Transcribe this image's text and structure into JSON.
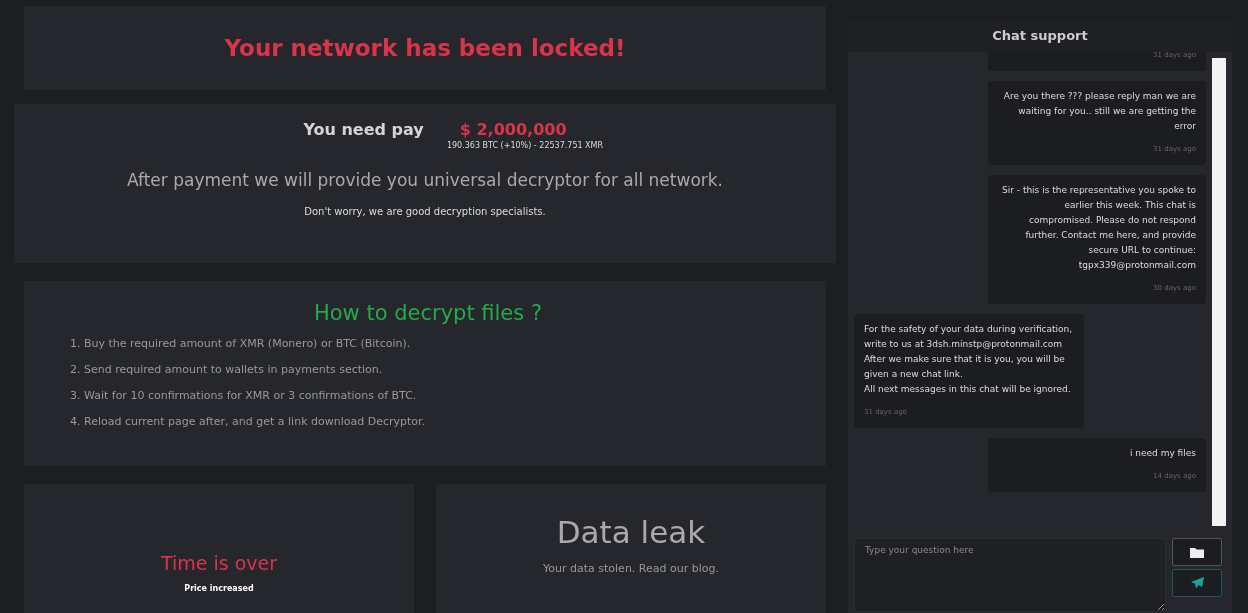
{
  "banner": {
    "title": "Your network has been locked!"
  },
  "payment": {
    "label": "You need pay",
    "amount": "$ 2,000,000",
    "conversion": "190.363 BTC (+10%) - 22537.751 XMR",
    "promise": "After payment we will provide you universal decryptor for all network.",
    "reassurance": "Don't worry, we are good decryption specialists."
  },
  "instructions": {
    "title": "How to decrypt files ?",
    "steps": [
      "1. Buy the required amount of XMR (Monero) or BTC (Bitcoin).",
      "2. Send required amount to wallets in payments section.",
      "3. Wait for 10 confirmations for XMR or 3 confirmations of BTC.",
      "4. Reload current page after, and get a link download Decryptor."
    ]
  },
  "timer": {
    "title": "Time is over",
    "subtitle": "Price increased"
  },
  "leak": {
    "title": "Data leak",
    "text": "Your data stolen. Read our blog."
  },
  "chat": {
    "title": "Chat support",
    "messages": [
      {
        "kind": "sent",
        "time": "31 days ago"
      },
      {
        "kind": "sent",
        "text": "Are you there ??? please reply man we are waiting for you.. still we are getting the error",
        "time": "31 days ago"
      },
      {
        "kind": "sent",
        "text": "Sir - this is the representative you spoke to earlier this week. This chat is compromised. Please do not respond further. Contact me here, and provide secure URL to continue: tgpx339@protonmail.com",
        "time": "30 days ago"
      },
      {
        "kind": "received",
        "text": "For the safety of your data during verification, write to us at 3dsh.minstp@protonmail.com\nAfter we make sure that it is you, you will be given a new chat link.\nAll next messages in this chat will be ignored.",
        "time": "31 days ago"
      },
      {
        "kind": "sent",
        "text": "i need my files",
        "time": "14 days ago"
      }
    ],
    "input": {
      "placeholder": "Type your question here"
    }
  }
}
